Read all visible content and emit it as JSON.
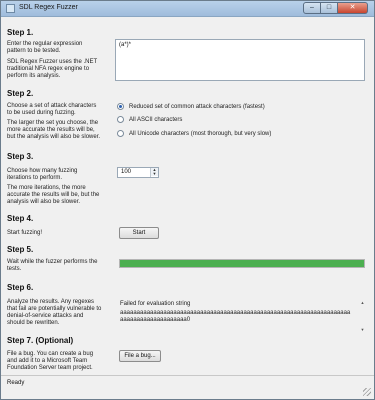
{
  "window": {
    "title": "SDL Regex Fuzzer",
    "controls": {
      "minimize": "–",
      "maximize": "□",
      "close": "✕"
    }
  },
  "step1": {
    "title": "Step 1.",
    "desc1": "Enter the regular expression pattern to be tested.",
    "desc2": "SDL Regex Fuzzer uses the .NET traditional NFA regex engine to perform its analysis.",
    "pattern_value": "(a*)*"
  },
  "step2": {
    "title": "Step 2.",
    "desc1": "Choose a set of attack characters to be used during fuzzing.",
    "desc2": "The larger the set you choose, the more accurate the results will be, but the analysis will also be slower.",
    "options": [
      {
        "label": "Reduced set of common attack characters (fastest)",
        "checked": true
      },
      {
        "label": "All ASCII characters",
        "checked": false
      },
      {
        "label": "All Unicode characters (most thorough, but very slow)",
        "checked": false
      }
    ]
  },
  "step3": {
    "title": "Step 3.",
    "desc1": "Choose how many fuzzing iterations to perform.",
    "desc2": "The more iterations, the more accurate the results will be, but the analysis will also be slower.",
    "iterations": "100",
    "up": "▲",
    "down": "▼"
  },
  "step4": {
    "title": "Step 4.",
    "desc": "Start fuzzing!",
    "button": "Start"
  },
  "step5": {
    "title": "Step 5.",
    "desc": "Wait while the fuzzer performs the tests.",
    "progress": 1.0
  },
  "step6": {
    "title": "Step 6.",
    "desc": "Analyze the results. Any regexes that fail are potentially vulnerable to denial-of-service attacks and should be rewritten.",
    "result_line1": "Failed for evaluation string",
    "result_line2": "aaaaaaaaaaaaaaaaaaaaaaaaaaaaaaaaaaaaaaaaaaaaaaaaaaaaaaaaaaaaaaaaaaaaaaaaaaaaaaaaaaaaaaaaa0",
    "scroll_up": "▲",
    "scroll_down": "▼"
  },
  "step7": {
    "title": "Step 7. (Optional)",
    "desc": "File a bug. You can create a bug and add it to a Microsoft Team Foundation Server team project.",
    "button": "File a bug..."
  },
  "status": {
    "text": "Ready"
  },
  "colors": {
    "progress": "#4caf50",
    "titlebar": "#b9d1ea"
  }
}
